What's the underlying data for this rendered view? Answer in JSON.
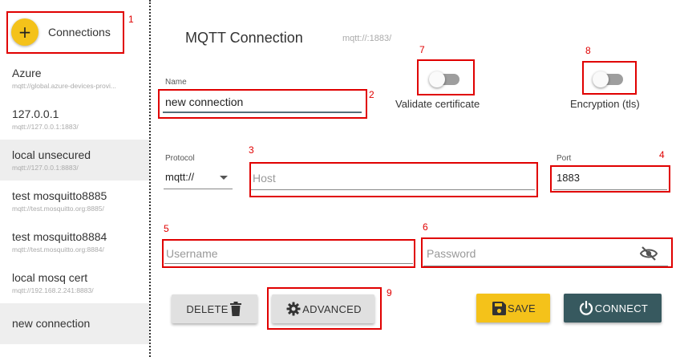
{
  "sidebar": {
    "add_button_icon": "plus-icon",
    "add_label": "Connections",
    "connections": [
      {
        "name": "Azure",
        "url": "mqtt://global.azure-devices-provi...",
        "selected": false
      },
      {
        "name": "127.0.0.1",
        "url": "mqtt://127.0.0.1:1883/",
        "selected": false
      },
      {
        "name": "local unsecured",
        "url": "mqtt://127.0.0.1:8883/",
        "selected": true
      },
      {
        "name": "test mosquitto8885",
        "url": "mqtt://test.mosquitto.org:8885/",
        "selected": false
      },
      {
        "name": "test mosquitto8884",
        "url": "mqtt://test.mosquitto.org:8884/",
        "selected": false
      },
      {
        "name": "local mosq cert",
        "url": "mqtt://192.168.2.241:8883/",
        "selected": false
      },
      {
        "name": "new connection",
        "url": "",
        "selected": true
      }
    ]
  },
  "form": {
    "title": "MQTT Connection",
    "title_url": "mqtt://:1883/",
    "name_label": "Name",
    "name_value": "new connection",
    "validate_label": "Validate certificate",
    "validate_on": false,
    "encryption_label": "Encryption (tls)",
    "encryption_on": false,
    "protocol_label": "Protocol",
    "protocol_value": "mqtt://",
    "host_placeholder": "Host",
    "host_value": "",
    "port_label": "Port",
    "port_value": "1883",
    "username_placeholder": "Username",
    "password_placeholder": "Password"
  },
  "actions": {
    "delete_label": "DELETE",
    "advanced_label": "ADVANCED",
    "save_label": "SAVE",
    "connect_label": "CONNECT"
  },
  "annotations": [
    "1",
    "2",
    "3",
    "4",
    "5",
    "6",
    "7",
    "8",
    "9"
  ],
  "colors": {
    "accent_yellow": "#f4c21a",
    "connect_button": "#37595f",
    "annotation_red": "#e00000"
  }
}
